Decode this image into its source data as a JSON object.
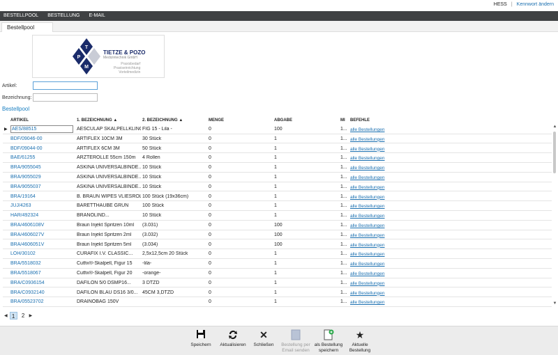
{
  "user": {
    "name": "HESS",
    "separator": "|",
    "change_password": "Kennwort ändern"
  },
  "nav": [
    "BESTELLPOOL",
    "BESTELLUNG",
    "E-MAIL"
  ],
  "tab": "Bestellpool",
  "logo": {
    "company": "TIETZE & POZO",
    "sub": "Medizintechnik GmbH",
    "tag1": "Praxisbedarf",
    "tag2": "Praxiseinrichtung",
    "tag3": "Vorteilmedizin",
    "letters": [
      "T",
      "P",
      "M"
    ]
  },
  "form": {
    "artikel_label": "Artikel:",
    "artikel_value": "",
    "bezeichnung_label": "Bezeichnung:",
    "bezeichnung_value": ""
  },
  "section_title": "Bestellpool",
  "columns": {
    "artikel": "ARTIKEL",
    "b1": "1. BEZEICHNUNG ▲",
    "b2": "2. BEZEICHNUNG ▲",
    "menge": "MENGE",
    "abgabe": "ABGABE",
    "mi": "MI",
    "befehle": "BEFEHLE"
  },
  "rows": [
    {
      "artikel": "AES/88515",
      "b1": "AESCULAP SKALPELLKLINGE",
      "b2": "FIG 15   - Lila -",
      "menge": "0",
      "abgabe": "100",
      "mi": "1...",
      "befehl": "alle Bestellungen"
    },
    {
      "artikel": "BDF/09046-00",
      "b1": "ARTIFLEX 10CM 3M",
      "b2": "30 Stück",
      "menge": "0",
      "abgabe": "1",
      "mi": "1...",
      "befehl": "alle Bestellungen"
    },
    {
      "artikel": "BDF/09044-00",
      "b1": "ARTIFLEX 6CM 3M",
      "b2": "50 Stück",
      "menge": "0",
      "abgabe": "1",
      "mi": "1...",
      "befehl": "alle Bestellungen"
    },
    {
      "artikel": "BAE/61255",
      "b1": "ÄRZTEROLLE 55cm 150m",
      "b2": "4 Rollen",
      "menge": "0",
      "abgabe": "1",
      "mi": "1...",
      "befehl": "alle Bestellungen"
    },
    {
      "artikel": "BRA/9055045",
      "b1": "ASKINA UNIVERSALBINDE...",
      "b2": "10 Stück",
      "menge": "0",
      "abgabe": "1",
      "mi": "1...",
      "befehl": "alle Bestellungen"
    },
    {
      "artikel": "BRA/9055029",
      "b1": "ASKINA UNIVERSALBINDE...",
      "b2": "10 Stück",
      "menge": "0",
      "abgabe": "1",
      "mi": "1...",
      "befehl": "alle Bestellungen"
    },
    {
      "artikel": "BRA/9055037",
      "b1": "ASKINA UNIVERSALBINDE...",
      "b2": "10 Stück",
      "menge": "0",
      "abgabe": "1",
      "mi": "1...",
      "befehl": "alle Bestellungen"
    },
    {
      "artikel": "BRA/19164",
      "b1": "B. BRAUN WIPES VLIESROLLE",
      "b2": "100 Stück (19x36cm)",
      "menge": "0",
      "abgabe": "1",
      "mi": "1...",
      "befehl": "alle Bestellungen"
    },
    {
      "artikel": "JUJ/4263",
      "b1": "BARETTHAUBE GRÜN",
      "b2": "100 Stück",
      "menge": "0",
      "abgabe": "1",
      "mi": "1...",
      "befehl": "alle Bestellungen"
    },
    {
      "artikel": "HAR/492324",
      "b1": "BRANOLIND...",
      "b2": "10 Stück",
      "menge": "0",
      "abgabe": "1",
      "mi": "1...",
      "befehl": "alle Bestellungen"
    },
    {
      "artikel": "BRA/4606108V",
      "b1": "Braun Injekt Spritzen 10ml",
      "b2": "(3.031)",
      "menge": "0",
      "abgabe": "100",
      "mi": "1...",
      "befehl": "alle Bestellungen"
    },
    {
      "artikel": "BRA/4606027V",
      "b1": "Braun Injekt Spritzen 2ml",
      "b2": "(3.032)",
      "menge": "0",
      "abgabe": "100",
      "mi": "1...",
      "befehl": "alle Bestellungen"
    },
    {
      "artikel": "BRA/4606051V",
      "b1": "Braun Injekt Spritzen 5ml",
      "b2": "(3.034)",
      "menge": "0",
      "abgabe": "100",
      "mi": "1...",
      "befehl": "alle Bestellungen"
    },
    {
      "artikel": "LOH/30102",
      "b1": "CURAFIX I.V. CLASSIC...",
      "b2": "2,5x12,5cm   20 Stück",
      "menge": "0",
      "abgabe": "1",
      "mi": "1...",
      "befehl": "alle Bestellungen"
    },
    {
      "artikel": "BRA/5518032",
      "b1": "Cutfix®-Skalpell, Figur 15",
      "b2": "-lila-",
      "menge": "0",
      "abgabe": "1",
      "mi": "1...",
      "befehl": "alle Bestellungen"
    },
    {
      "artikel": "BRA/5518067",
      "b1": "Cutfix®-Skalpell, Figur 20",
      "b2": "-orange-",
      "menge": "0",
      "abgabe": "1",
      "mi": "1...",
      "befehl": "alle Bestellungen"
    },
    {
      "artikel": "BRA/C0936154",
      "b1": "DAFILON 5/0  DSMP16...",
      "b2": "3 DTZD",
      "menge": "0",
      "abgabe": "1",
      "mi": "1...",
      "befehl": "alle Bestellungen"
    },
    {
      "artikel": "BRA/C0932140",
      "b1": "DAFILON BLAU  DS16  3/0...",
      "b2": "45CM    3,DTZD",
      "menge": "0",
      "abgabe": "1",
      "mi": "1...",
      "befehl": "alle Bestellungen"
    },
    {
      "artikel": "BRA/05523702",
      "b1": "DRAINOBAG 150V",
      "b2": "",
      "menge": "0",
      "abgabe": "1",
      "mi": "1...",
      "befehl": "alle Bestellungen"
    }
  ],
  "pager": {
    "pages": [
      "1",
      "2"
    ],
    "current": "1"
  },
  "toolbar": {
    "speichern": "Speichern",
    "aktualisieren": "Aktualisieren",
    "schliessen": "Schließen",
    "email1": "Bestellung per",
    "email2": "Email senden",
    "als1": "als Bestellung",
    "als2": "speichern",
    "aktuelle1": "Aktuelle",
    "aktuelle2": "Bestellung"
  },
  "colors": {
    "nav_bg": "#3f4143",
    "link": "#1a6fb0",
    "section": "#1a7fc1"
  }
}
